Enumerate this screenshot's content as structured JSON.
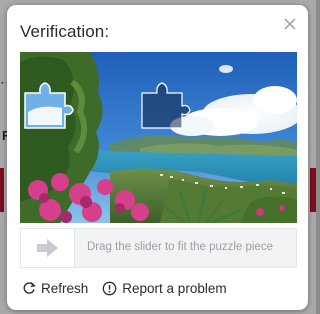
{
  "modal": {
    "title": "Verification:"
  },
  "slider": {
    "hint": "Drag the slider to fit the puzzle piece",
    "position": 0
  },
  "footer": {
    "refresh_label": "Refresh",
    "report_label": "Report a problem"
  },
  "icons": {
    "close": "close-icon",
    "refresh": "refresh-icon",
    "report": "info-icon",
    "slider_arrow": "arrow-right-icon"
  },
  "colors": {
    "modal_bg": "#ffffff",
    "text": "#2b2b2b",
    "hint": "#9a9ea4",
    "track": "#f2f3f4",
    "arrow": "#c8cbcf"
  }
}
